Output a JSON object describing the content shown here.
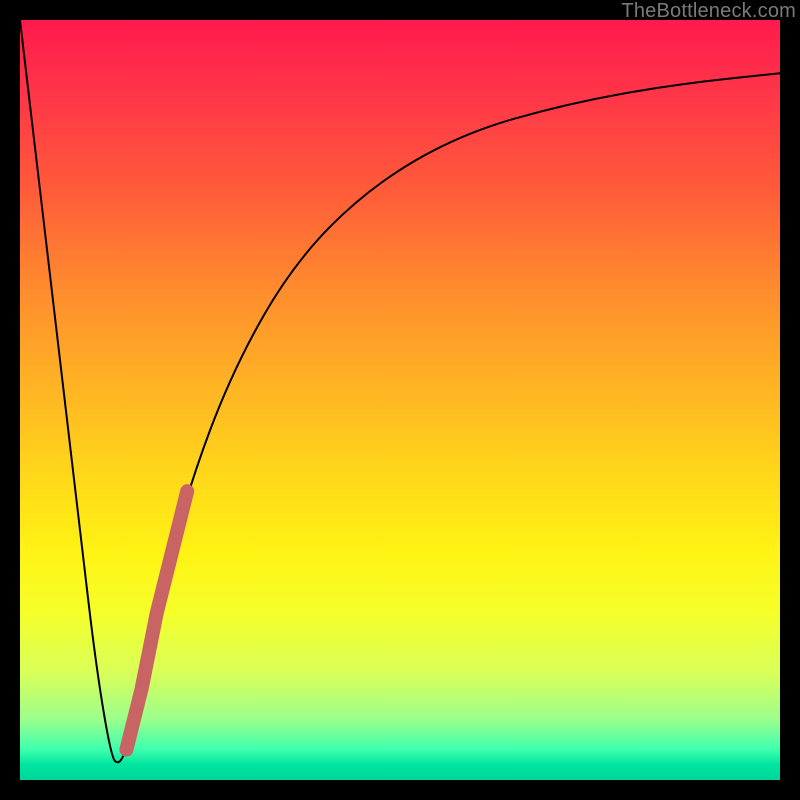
{
  "watermark": "TheBottleneck.com",
  "chart_data": {
    "type": "line",
    "title": "",
    "xlabel": "",
    "ylabel": "",
    "xlim": [
      0,
      100
    ],
    "ylim": [
      0,
      100
    ],
    "grid": false,
    "legend": false,
    "series": [
      {
        "name": "bottleneck-curve",
        "x": [
          0,
          4,
          8,
          10,
          12,
          13,
          14,
          16,
          18,
          22,
          28,
          36,
          46,
          58,
          72,
          86,
          100
        ],
        "y": [
          100,
          66,
          32,
          15,
          3,
          2,
          4,
          12,
          22,
          38,
          54,
          68,
          78,
          85,
          89,
          91.5,
          93
        ]
      },
      {
        "name": "highlighted-segment",
        "x": [
          14,
          16,
          18,
          20,
          22
        ],
        "y": [
          4,
          12,
          22,
          30,
          38
        ]
      }
    ]
  },
  "colors": {
    "frame": "#000000",
    "curve": "#000000",
    "highlight": "#c86464",
    "gradient_top": "#ff1a4d",
    "gradient_mid": "#ffd81a",
    "gradient_bottom": "#00d69b",
    "watermark": "#7a7a7a"
  }
}
